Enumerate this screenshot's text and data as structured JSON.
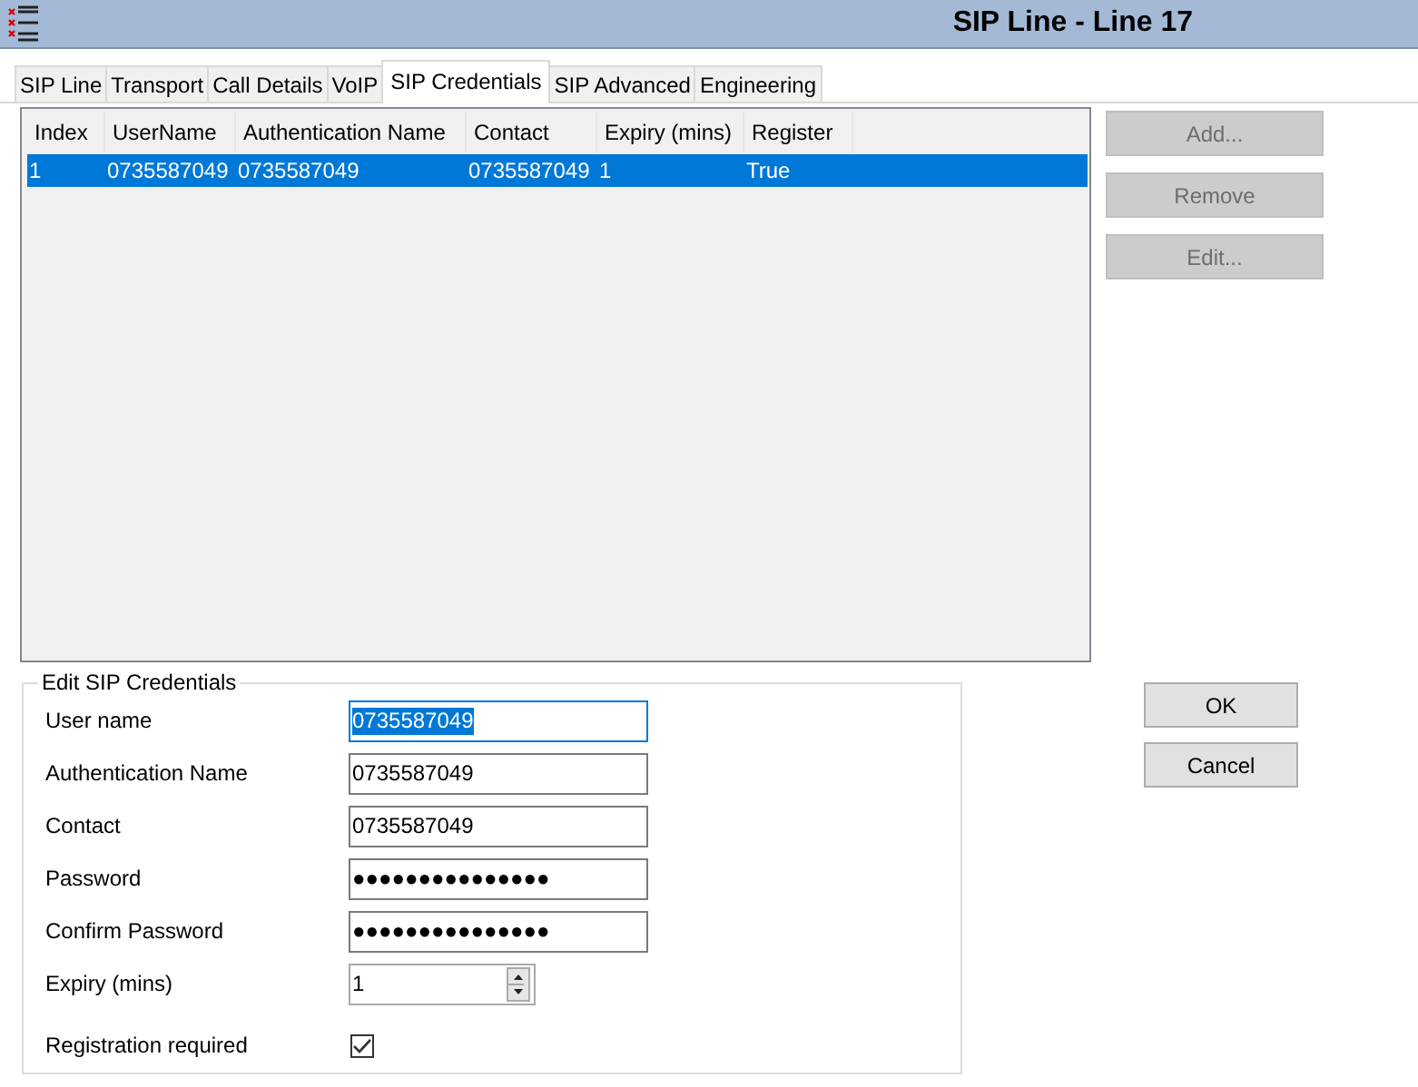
{
  "window": {
    "title": "SIP Line - Line 17"
  },
  "tabs": [
    {
      "label": "SIP Line",
      "selected": false
    },
    {
      "label": "Transport",
      "selected": false
    },
    {
      "label": "Call Details",
      "selected": false
    },
    {
      "label": "VoIP",
      "selected": false
    },
    {
      "label": "SIP Credentials",
      "selected": true
    },
    {
      "label": "SIP Advanced",
      "selected": false
    },
    {
      "label": "Engineering",
      "selected": false
    }
  ],
  "table": {
    "columns": [
      "Index",
      "UserName",
      "Authentication Name",
      "Contact",
      "Expiry (mins)",
      "Register"
    ],
    "rows": [
      {
        "cells": [
          "1",
          "0735587049",
          "0735587049",
          "0735587049",
          "1",
          "True"
        ],
        "selected": true
      }
    ]
  },
  "side_buttons": [
    {
      "label": "Add...",
      "disabled": true
    },
    {
      "label": "Remove",
      "disabled": true
    },
    {
      "label": "Edit...",
      "disabled": true
    }
  ],
  "edit_group": {
    "title": "Edit SIP Credentials",
    "fields": [
      {
        "kind": "text",
        "label": "User name",
        "value": "0735587049",
        "focused": true
      },
      {
        "kind": "text",
        "label": "Authentication Name",
        "value": "0735587049",
        "focused": false
      },
      {
        "kind": "text",
        "label": "Contact",
        "value": "0735587049",
        "focused": false
      },
      {
        "kind": "text",
        "label": "Password",
        "value": "●●●●●●●●●●●●●●●",
        "focused": false
      },
      {
        "kind": "text",
        "label": "Confirm Password",
        "value": "●●●●●●●●●●●●●●●",
        "focused": false
      },
      {
        "kind": "spin",
        "label": "Expiry (mins)",
        "value": "1"
      },
      {
        "kind": "checkbox",
        "label": "Registration required",
        "checked": true
      }
    ]
  },
  "dialog_buttons": [
    {
      "label": "OK",
      "disabled": false
    },
    {
      "label": "Cancel",
      "disabled": false
    }
  ]
}
